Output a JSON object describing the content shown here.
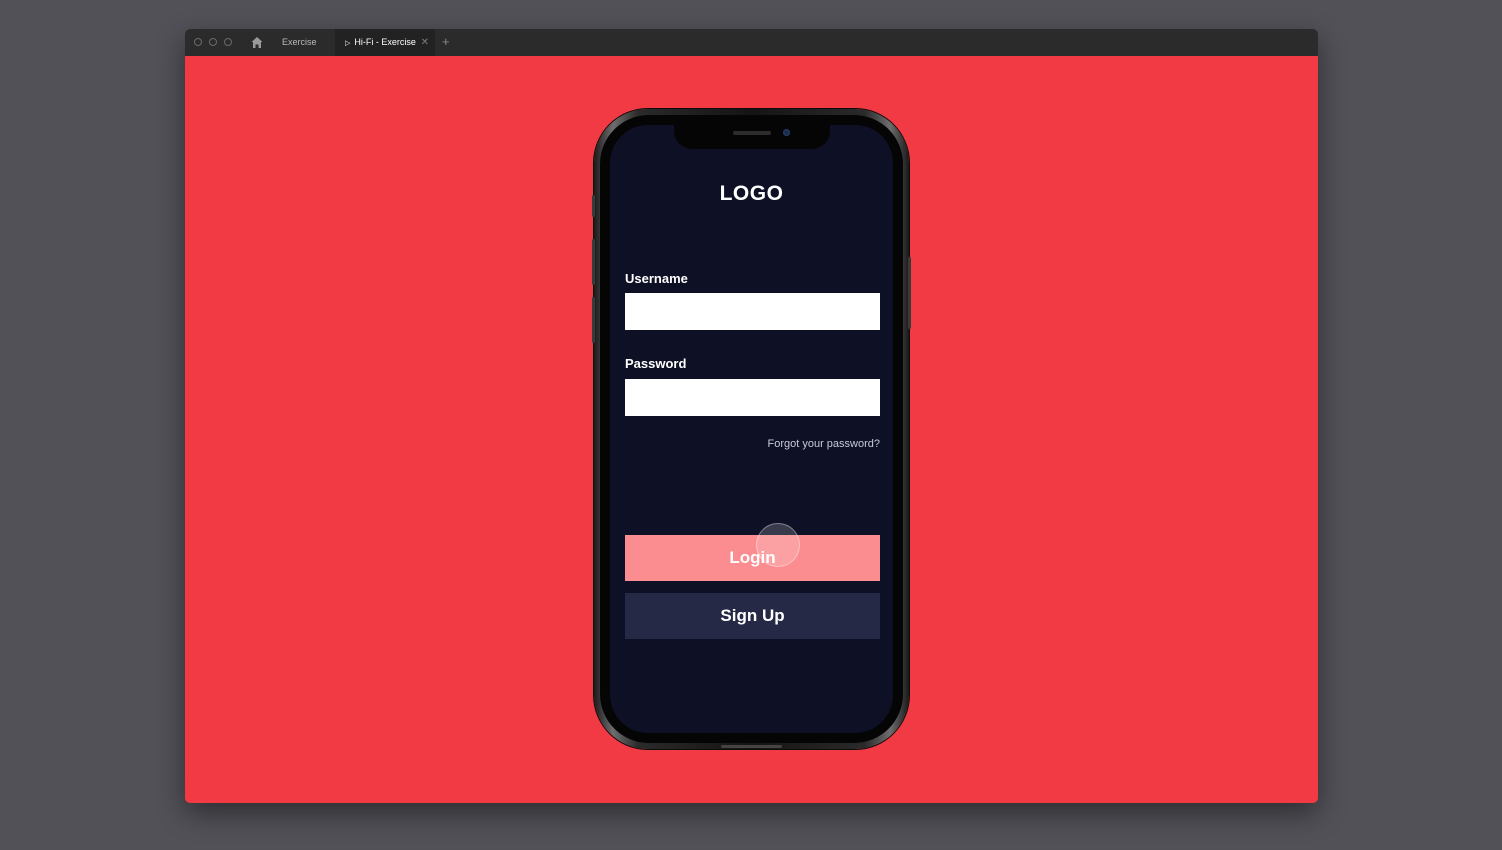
{
  "window": {
    "tabs": [
      {
        "label": "Exercise",
        "active": false
      },
      {
        "label": "Hi-Fi - Exercise",
        "active": true
      }
    ],
    "icons": {
      "home": "home-icon",
      "play": "play-icon",
      "close": "close-icon",
      "new_tab": "plus-icon"
    },
    "glyphs": {
      "play": "▷",
      "close": "✕",
      "plus": "+"
    },
    "background_color": "#f23a45"
  },
  "app": {
    "logo": "LOGO",
    "username_label": "Username",
    "username_value": "",
    "password_label": "Password",
    "password_value": "",
    "forgot_password": "Forgot your password?",
    "login_label": "Login",
    "signup_label": "Sign Up",
    "colors": {
      "screen_bg": "#0e1026",
      "login_bg": "#fb8d91",
      "signup_bg": "#252946"
    }
  }
}
